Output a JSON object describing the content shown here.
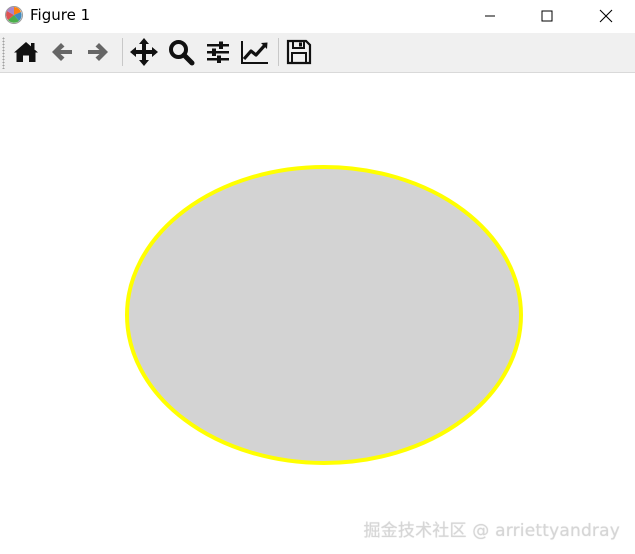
{
  "window": {
    "title": "Figure 1",
    "app_icon": "matplotlib-icon",
    "controls": [
      "minimize-icon",
      "maximize-icon",
      "close-icon"
    ]
  },
  "toolbar": {
    "buttons": [
      {
        "name": "home",
        "icon": "home-icon"
      },
      {
        "name": "back",
        "icon": "arrow-left-icon"
      },
      {
        "name": "forward",
        "icon": "arrow-right-icon"
      },
      {
        "name": "pan",
        "icon": "move-icon"
      },
      {
        "name": "zoom",
        "icon": "magnifier-icon"
      },
      {
        "name": "configure-subplots",
        "icon": "sliders-icon"
      },
      {
        "name": "edit-axes",
        "icon": "line-chart-icon"
      },
      {
        "name": "save",
        "icon": "floppy-disk-icon"
      }
    ]
  },
  "plot": {
    "shape": "ellipse",
    "fill_color": "#d3d3d3",
    "edge_color": "#ffff00"
  },
  "watermark": {
    "text": "掘金技术社区 @ arriettyandray"
  },
  "colors": {
    "toolbar_bg": "#f0f0f0",
    "icon_dark": "#111111",
    "icon_gray": "#666666"
  }
}
